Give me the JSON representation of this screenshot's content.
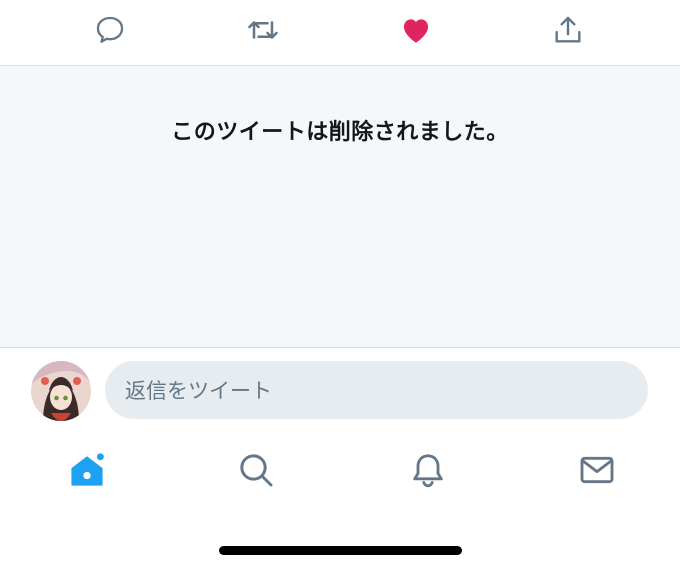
{
  "actions": {
    "reply_icon": "speech-bubble",
    "retweet_icon": "retweet-arrows",
    "like_icon": "heart",
    "share_icon": "share-upload"
  },
  "deleted_message": "このツイートは削除されました。",
  "reply": {
    "placeholder": "返信をツイート"
  },
  "tabs": [
    {
      "icon": "home",
      "active": true,
      "has_dot": true
    },
    {
      "icon": "search",
      "active": false
    },
    {
      "icon": "notifications",
      "active": false
    },
    {
      "icon": "messages",
      "active": false
    }
  ],
  "colors": {
    "accent": "#1da1f2",
    "like": "#e0245e",
    "icon_gray": "#657786",
    "panel_bg": "#f5f8fa"
  }
}
